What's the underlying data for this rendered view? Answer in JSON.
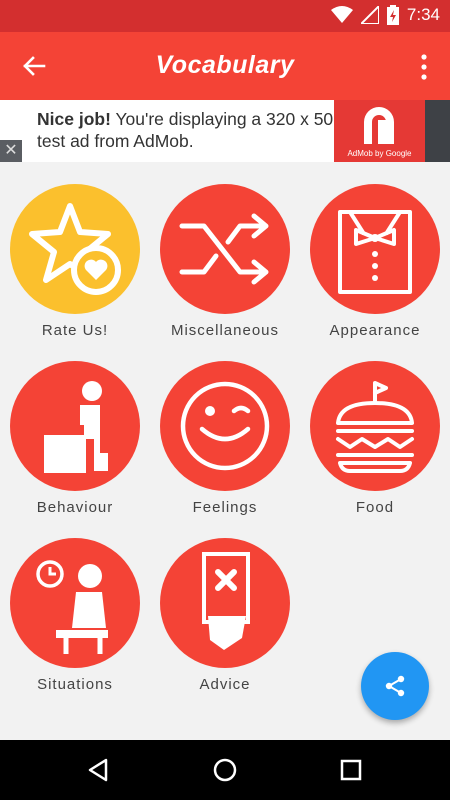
{
  "status_bar": {
    "time": "7:34",
    "icons": [
      "wifi-icon",
      "signal-icon",
      "battery-charging-icon"
    ]
  },
  "app_bar": {
    "title": "Vocabulary",
    "back_icon": "arrow-left-icon",
    "menu_icon": "more-vert-icon"
  },
  "ad": {
    "headline": "Nice job!",
    "body": " You're displaying a 320 x 50 test ad from AdMob.",
    "brand": "AdMob by Google",
    "close_label": "✕"
  },
  "tiles": [
    {
      "label": "Rate Us!",
      "icon": "star-heart-icon",
      "color": "#fbc02d"
    },
    {
      "label": "Miscellaneous",
      "icon": "shuffle-icon",
      "color": "#f44336"
    },
    {
      "label": "Appearance",
      "icon": "shirt-bowtie-icon",
      "color": "#f44336"
    },
    {
      "label": "Behaviour",
      "icon": "seated-person-icon",
      "color": "#f44336"
    },
    {
      "label": "Feelings",
      "icon": "wink-face-icon",
      "color": "#f44336"
    },
    {
      "label": "Food",
      "icon": "burger-icon",
      "color": "#f44336"
    },
    {
      "label": "Situations",
      "icon": "waiting-room-icon",
      "color": "#f44336"
    },
    {
      "label": "Advice",
      "icon": "hand-card-icon",
      "color": "#f44336"
    }
  ],
  "fab": {
    "icon": "share-icon",
    "color": "#2196f3"
  },
  "nav_bar": {
    "icons": [
      "back-triangle-icon",
      "home-circle-icon",
      "recents-square-icon"
    ]
  }
}
